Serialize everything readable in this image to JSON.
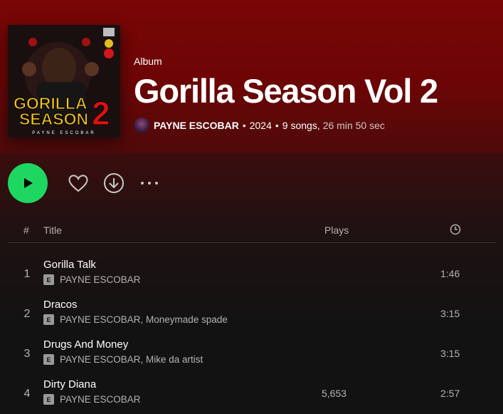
{
  "album": {
    "type_label": "Album",
    "title": "Gorilla Season Vol 2",
    "cover_text": {
      "line1": "GORILLA",
      "line2": "SEASON",
      "numeral": "2",
      "artist": "PAYNE ESCOBAR"
    },
    "artist": "PAYNE ESCOBAR",
    "separator": "•",
    "year": "2024",
    "songs": "9 songs,",
    "duration": "26 min 50 sec"
  },
  "icons": {
    "play": "play-icon",
    "like": "heart-icon",
    "download": "download-icon",
    "more": "more-icon",
    "duration": "clock-icon"
  },
  "table": {
    "headers": {
      "num": "#",
      "title": "Title",
      "plays": "Plays"
    },
    "explicit_label": "E",
    "tracks": [
      {
        "num": "1",
        "title": "Gorilla Talk",
        "artists": "PAYNE ESCOBAR",
        "plays": "",
        "duration": "1:46"
      },
      {
        "num": "2",
        "title": "Dracos",
        "artists": "PAYNE ESCOBAR, Moneymade spade",
        "plays": "",
        "duration": "3:15"
      },
      {
        "num": "3",
        "title": "Drugs And Money",
        "artists": "PAYNE ESCOBAR, Mike da artist",
        "plays": "",
        "duration": "3:15"
      },
      {
        "num": "4",
        "title": "Dirty Diana",
        "artists": "PAYNE ESCOBAR",
        "plays": "5,653",
        "duration": "2:57"
      }
    ]
  },
  "colors": {
    "header_bg": "#7a0606",
    "play_button": "#1ed760",
    "background": "#121212",
    "muted_text": "#b3b3b3"
  }
}
